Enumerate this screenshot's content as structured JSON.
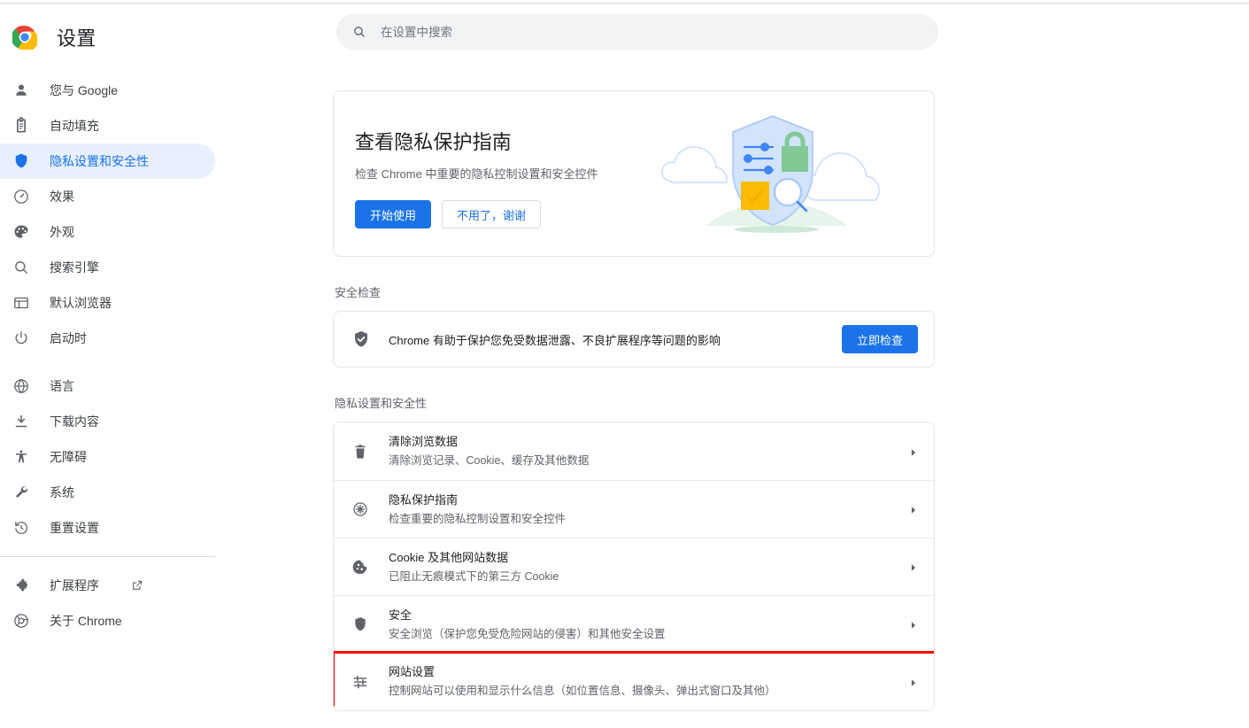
{
  "window": {
    "brand_title": "设置",
    "logo_icon": "chrome-logo-icon"
  },
  "search": {
    "placeholder": "在设置中搜索",
    "value": "",
    "icon": "search-icon"
  },
  "sidebar": {
    "items": [
      {
        "label": "您与 Google",
        "icon": "person-icon",
        "selected": false
      },
      {
        "label": "自动填充",
        "icon": "clipboard-icon",
        "selected": false
      },
      {
        "label": "隐私设置和安全性",
        "icon": "shield-icon",
        "selected": true
      },
      {
        "label": "效果",
        "icon": "speedometer-icon",
        "selected": false
      },
      {
        "label": "外观",
        "icon": "palette-icon",
        "selected": false
      },
      {
        "label": "搜索引擎",
        "icon": "magnifier-icon",
        "selected": false
      },
      {
        "label": "默认浏览器",
        "icon": "browser-window-icon",
        "selected": false
      },
      {
        "label": "启动时",
        "icon": "power-icon",
        "selected": false
      }
    ],
    "items_group2": [
      {
        "label": "语言",
        "icon": "globe-icon"
      },
      {
        "label": "下载内容",
        "icon": "download-icon"
      },
      {
        "label": "无障碍",
        "icon": "accessibility-icon"
      },
      {
        "label": "系统",
        "icon": "wrench-icon"
      },
      {
        "label": "重置设置",
        "icon": "restore-icon"
      }
    ],
    "items_group3": [
      {
        "label": "扩展程序",
        "icon": "puzzle-icon",
        "external": true,
        "external_icon": "external-link-icon"
      },
      {
        "label": "关于 Chrome",
        "icon": "chrome-outline-icon",
        "external": false
      }
    ]
  },
  "promo": {
    "title": "查看隐私保护指南",
    "subtitle": "检查 Chrome 中重要的隐私控制设置和安全控件",
    "primary_label": "开始使用",
    "secondary_label": "不用了，谢谢",
    "illustration": "privacy-shield-illustration"
  },
  "safety_check": {
    "section_title": "安全检查",
    "icon": "shield-check-icon",
    "text": "Chrome 有助于保护您免受数据泄露、不良扩展程序等问题的影响",
    "button_label": "立即检查"
  },
  "privacy_section": {
    "section_title": "隐私设置和安全性",
    "rows": [
      {
        "title": "清除浏览数据",
        "subtitle": "清除浏览记录、Cookie、缓存及其他数据",
        "icon": "trash-icon",
        "highlighted": false
      },
      {
        "title": "隐私保护指南",
        "subtitle": "检查重要的隐私控制设置和安全控件",
        "icon": "privacy-guide-icon",
        "highlighted": false
      },
      {
        "title": "Cookie 及其他网站数据",
        "subtitle": "已阻止无痕模式下的第三方 Cookie",
        "icon": "cookie-icon",
        "highlighted": false
      },
      {
        "title": "安全",
        "subtitle": "安全浏览（保护您免受危险网站的侵害）和其他安全设置",
        "icon": "shield-outline-icon",
        "highlighted": false
      },
      {
        "title": "网站设置",
        "subtitle": "控制网站可以使用和显示什么信息（如位置信息、摄像头、弹出式窗口及其他）",
        "icon": "tune-icon",
        "highlighted": true
      }
    ]
  },
  "colors": {
    "accent_blue": "#1a73e8",
    "selected_bg": "#e8f0fe",
    "annotation_red": "#ff0000",
    "text_primary": "#202124",
    "text_secondary": "#5f6368",
    "search_bg": "#f1f3f4",
    "illustration_green": "#81c995",
    "illustration_yellow": "#fbbc04",
    "illustration_shield": "#d2e3fc"
  }
}
